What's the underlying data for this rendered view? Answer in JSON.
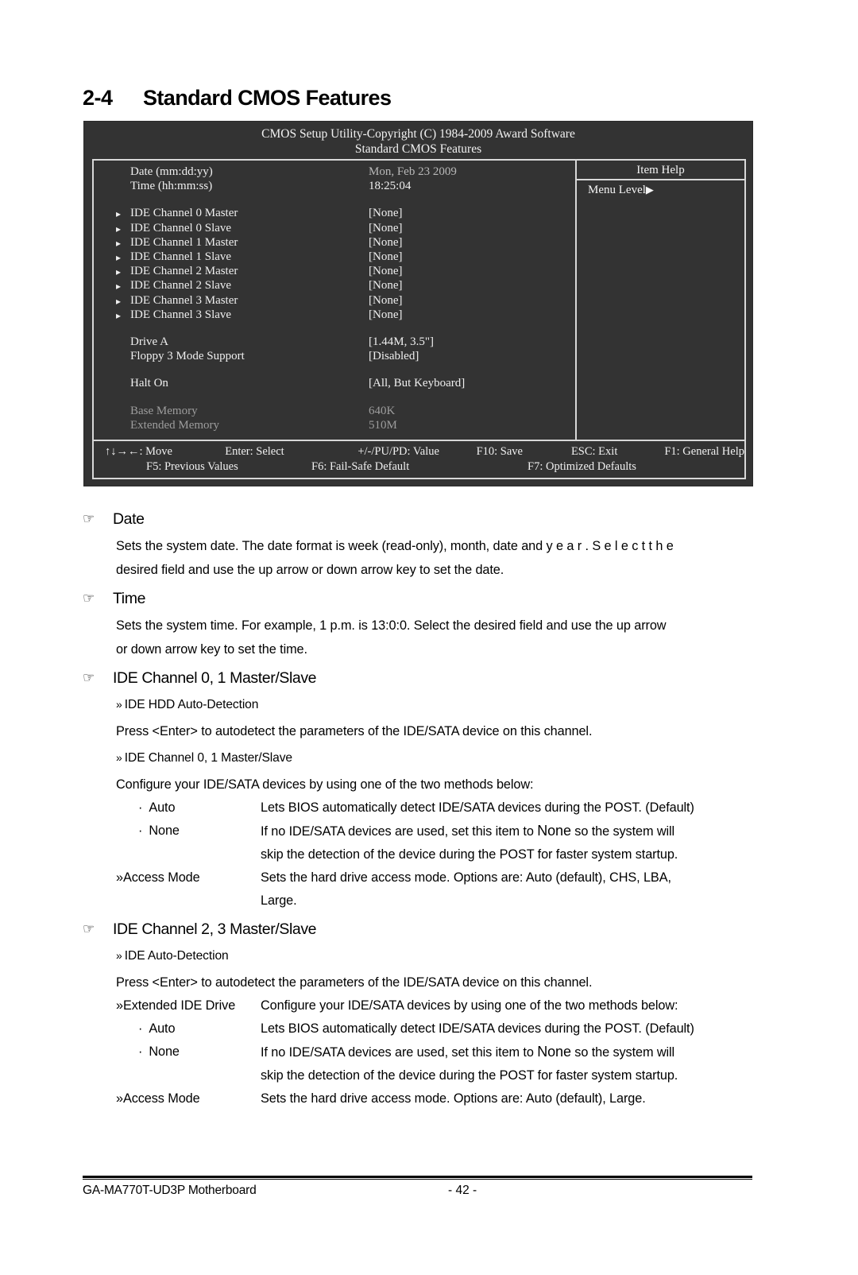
{
  "page": {
    "section_number": "2-4",
    "section_title": "Standard CMOS Features",
    "footer_left": "GA-MA770T-UD3P Motherboard",
    "footer_center": "- 42 -"
  },
  "bios": {
    "title": "CMOS Setup Utility-Copyright (C) 1984-2009 Award Software",
    "subtitle": "Standard CMOS Features",
    "datetime_rows": [
      {
        "label": "Date  (mm:dd:yy)",
        "value": "Mon, Feb  23 2009"
      },
      {
        "label": "Time (hh:mm:ss)",
        "value": "18:25:04"
      }
    ],
    "ide_rows": [
      {
        "label": "IDE Channel 0 Master",
        "value": "[None]"
      },
      {
        "label": "IDE Channel 0 Slave",
        "value": "[None]"
      },
      {
        "label": "IDE Channel 1 Master",
        "value": "[None]"
      },
      {
        "label": "IDE Channel 1 Slave",
        "value": "[None]"
      },
      {
        "label": "IDE Channel 2 Master",
        "value": "[None]"
      },
      {
        "label": "IDE Channel 2 Slave",
        "value": "[None]"
      },
      {
        "label": "IDE Channel 3 Master",
        "value": "[None]"
      },
      {
        "label": "IDE Channel 3 Slave",
        "value": "[None]"
      }
    ],
    "drive_rows": [
      {
        "label": "Drive A",
        "value": "[1.44M, 3.5\"]"
      },
      {
        "label": "Floppy 3 Mode Support",
        "value": "[Disabled]"
      }
    ],
    "halt_rows": [
      {
        "label": "Halt On",
        "value": "[All, But Keyboard]"
      }
    ],
    "memory_rows": [
      {
        "label": "Base Memory",
        "value": "640K"
      },
      {
        "label": "Extended Memory",
        "value": "510M"
      }
    ],
    "help": {
      "title": "Item Help",
      "menu_level": "Menu Level",
      "menu_level_arrow": "▶"
    },
    "keys": {
      "move": "↑↓→←: Move",
      "select": "Enter: Select",
      "value": "+/-/PU/PD: Value",
      "save": "F10: Save",
      "exit": "ESC: Exit",
      "general_help": "F1: General Help",
      "previous_values": "F5: Previous Values",
      "fail_safe": "F6: Fail-Safe Default",
      "optimized": "F7: Optimized Defaults"
    },
    "colors": {
      "background": "#333333",
      "text": "#efefef",
      "dim_text": "#9d9d9d",
      "border": "#d8d8d8"
    }
  },
  "sections": [
    {
      "heading": "Date",
      "paragraphs": [
        "Sets the system date. The date format is week (read-only), month, date and  y e a r .   S e l e c t   t h e",
        "desired field and use the up arrow or down arrow key to set the date."
      ]
    },
    {
      "heading": "Time",
      "paragraphs": [
        "Sets the system time. For example, 1 p.m. is 13:0:0. Select the desired field and use the up arrow",
        "or down arrow key to set the time."
      ]
    },
    {
      "heading": "IDE Channel 0, 1 Master/Slave",
      "sub_items": [
        {
          "type": "subhead",
          "text": "IDE HDD Auto-Detection"
        },
        {
          "type": "para",
          "text": "Press <Enter> to autodetect the parameters of the IDE/SATA device on this channel."
        },
        {
          "type": "subhead",
          "text": "IDE Channel 0, 1 Master/Slave"
        },
        {
          "type": "para",
          "text": "Configure your IDE/SATA devices by using one of the two methods below:"
        }
      ],
      "options": [
        {
          "marker": "dot",
          "label": "Auto",
          "desc": "Lets BIOS automatically detect IDE/SATA devices during the POST. (Default)"
        },
        {
          "marker": "dot",
          "label": "None",
          "desc_pre": "If no IDE/SATA devices are used, set this item to ",
          "desc_em": "None",
          "desc_post": " so the system will",
          "desc_cont": "skip the detection of the device during the POST for faster system startup."
        },
        {
          "marker": "dblarrow",
          "label": "Access Mode",
          "desc": "Sets the hard drive access mode. Options are: Auto (default), CHS, LBA,",
          "desc_cont": "Large."
        }
      ]
    },
    {
      "heading": "IDE Channel 2, 3 Master/Slave",
      "sub_items": [
        {
          "type": "subhead",
          "text": "IDE Auto-Detection"
        },
        {
          "type": "para",
          "text": "Press <Enter> to autodetect the parameters of the IDE/SATA device on this channel."
        }
      ],
      "options": [
        {
          "marker": "dblarrow",
          "label": "Extended IDE Drive",
          "desc": "Configure your IDE/SATA devices by using one of the two methods below:"
        },
        {
          "marker": "dot",
          "label": "Auto",
          "desc": "Lets BIOS automatically detect IDE/SATA devices during the POST. (Default)"
        },
        {
          "marker": "dot",
          "label": "None",
          "desc_pre": "If no IDE/SATA devices are used, set this item to ",
          "desc_em": "None",
          "desc_post": " so the system will",
          "desc_cont": "skip the detection of the device during the POST for faster system startup."
        },
        {
          "marker": "dblarrow",
          "label": "Access Mode",
          "desc": "Sets the hard drive access mode. Options are: Auto (default), Large."
        }
      ]
    }
  ],
  "icons": {
    "hand_pointer": "☞",
    "double_arrow": "»",
    "bullet_dot": "·",
    "list_triangle": "▸"
  }
}
